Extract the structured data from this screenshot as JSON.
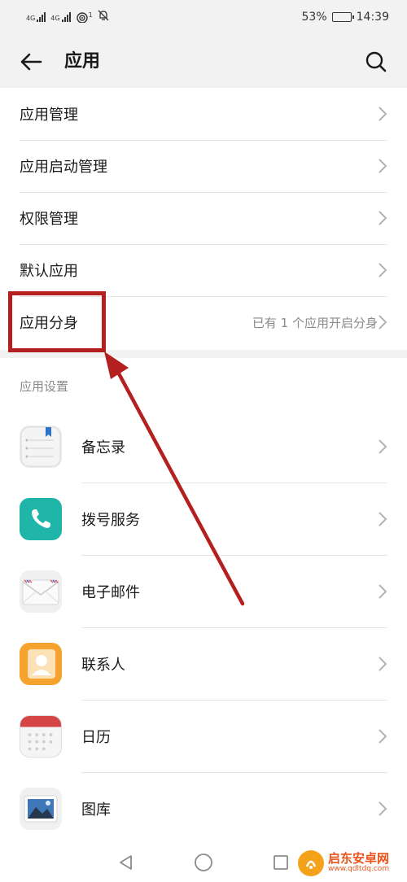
{
  "status_bar": {
    "signal_tag_1": "4G",
    "signal_tag_2": "4G",
    "wifi_sup": "1",
    "battery_percent": "53%",
    "battery_level": 0.53,
    "time": "14:39"
  },
  "header": {
    "title": "应用",
    "back_icon": "arrow-left-icon",
    "search_icon": "search-icon"
  },
  "top_list": [
    {
      "label": "应用管理",
      "value": ""
    },
    {
      "label": "应用启动管理",
      "value": ""
    },
    {
      "label": "权限管理",
      "value": ""
    },
    {
      "label": "默认应用",
      "value": ""
    },
    {
      "label": "应用分身",
      "value": "已有 1 个应用开启分身"
    }
  ],
  "app_settings": {
    "section_title": "应用设置",
    "apps": [
      {
        "label": "备忘录",
        "icon": "notepad-icon"
      },
      {
        "label": "拨号服务",
        "icon": "phone-icon"
      },
      {
        "label": "电子邮件",
        "icon": "mail-icon"
      },
      {
        "label": "联系人",
        "icon": "contacts-icon"
      },
      {
        "label": "日历",
        "icon": "calendar-icon"
      },
      {
        "label": "图库",
        "icon": "gallery-icon"
      }
    ]
  },
  "nav_bar": {
    "back": "triangle-back-icon",
    "home": "circle-home-icon",
    "recent": "square-recent-icon"
  },
  "watermark": {
    "name": "启东安卓网",
    "url": "www.qdltdq.com"
  },
  "colors": {
    "annotation": "#b42020",
    "accent_orange": "#e8541a"
  }
}
